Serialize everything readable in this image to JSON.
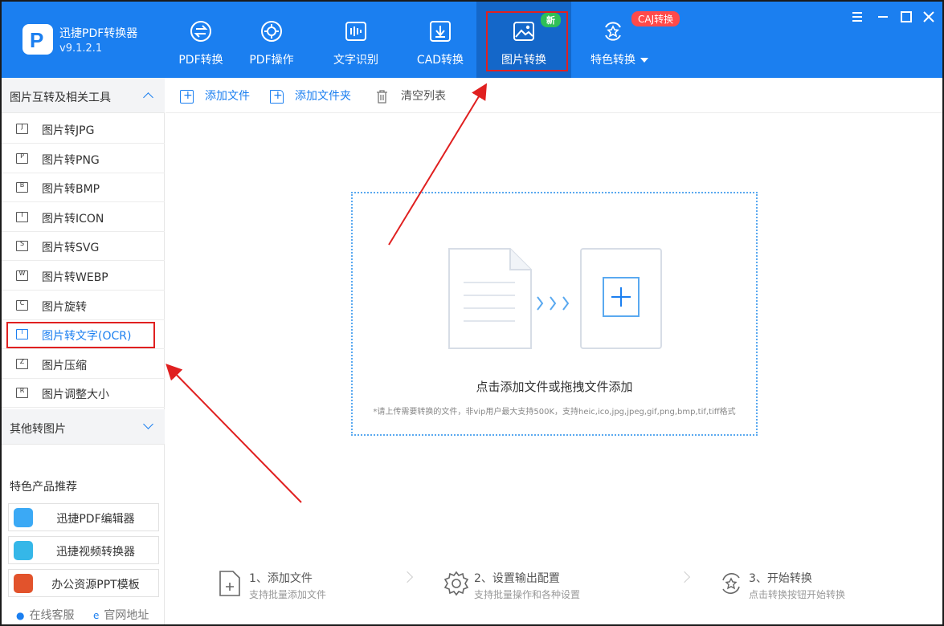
{
  "app": {
    "name": "迅捷PDF转换器",
    "version": "v9.1.2.1",
    "logo_letter": "P"
  },
  "nav": [
    {
      "label": "PDF转换",
      "icon": "pdf-convert-icon"
    },
    {
      "label": "PDF操作",
      "icon": "pdf-operate-icon"
    },
    {
      "label": "文字识别",
      "icon": "text-recognition-icon"
    },
    {
      "label": "CAD转换",
      "icon": "cad-convert-icon"
    },
    {
      "label": "图片转换",
      "icon": "image-convert-icon",
      "badge": "新",
      "active": true
    },
    {
      "label": "特色转换",
      "icon": "special-convert-icon",
      "badge": "CAJ转换",
      "has_dropdown": true
    }
  ],
  "window_controls": [
    "menu-icon",
    "minimize-icon",
    "maximize-icon",
    "close-icon"
  ],
  "sidebar": {
    "section1": "图片互转及相关工具",
    "items": [
      {
        "label": "图片转JPG",
        "glyph": "J"
      },
      {
        "label": "图片转PNG",
        "glyph": "P"
      },
      {
        "label": "图片转BMP",
        "glyph": "B"
      },
      {
        "label": "图片转ICON",
        "glyph": "I"
      },
      {
        "label": "图片转SVG",
        "glyph": "S"
      },
      {
        "label": "图片转WEBP",
        "glyph": "W"
      },
      {
        "label": "图片旋转",
        "glyph": "C"
      },
      {
        "label": "图片转文字(OCR)",
        "glyph": "T",
        "active": true
      },
      {
        "label": "图片压缩",
        "glyph": "Z"
      },
      {
        "label": "图片调整大小",
        "glyph": "R"
      }
    ],
    "section2": "其他转图片",
    "recommend_title": "特色产品推荐",
    "recommend": [
      {
        "label": "迅捷PDF编辑器"
      },
      {
        "label": "迅捷视频转换器"
      },
      {
        "label": "办公资源PPT模板"
      }
    ],
    "footer": {
      "service": "在线客服",
      "website": "官网地址"
    }
  },
  "toolbar": {
    "add_file": "添加文件",
    "add_folder": "添加文件夹",
    "clear_list": "清空列表"
  },
  "dropzone": {
    "title": "点击添加文件或拖拽文件添加",
    "hint": "*请上传需要转换的文件，非vip用户最大支持500K，支持heic,ico,jpg,jpeg,gif,png,bmp,tif,tiff格式"
  },
  "steps": [
    {
      "title": "1、添加文件",
      "sub": "支持批量添加文件"
    },
    {
      "title": "2、设置输出配置",
      "sub": "支持批量操作和各种设置"
    },
    {
      "title": "3、开始转换",
      "sub": "点击转换按钮开始转换"
    }
  ],
  "colors": {
    "brand": "#1b7ff0",
    "active_nav": "#1467c9",
    "highlight": "#e02020",
    "new_badge": "#2fbf57",
    "caj_badge": "#ff4a4a"
  }
}
